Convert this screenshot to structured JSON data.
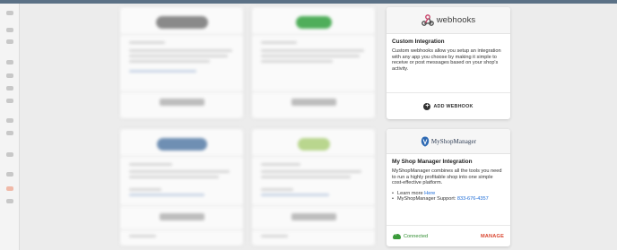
{
  "webhooks_card": {
    "logo_text": "webhooks",
    "title": "Custom Integration",
    "description": "Custom webhooks allow you setup an integration with any app you choose by making it simple to receive or post messages based on your shop's activity.",
    "button_label": "ADD WEBHOOK"
  },
  "msm_card": {
    "logo_text": "MyShopManager",
    "title": "My Shop Manager Integration",
    "description": "MyShopManager combines all the tools you need to run a highly profitable shop into one simple cost-effective platform.",
    "learn_more_prefix": "Learn more ",
    "learn_more_link": "Here",
    "support_prefix": "MyShopManager Support: ",
    "support_phone": "833-676-4357",
    "status_label": "Connected",
    "manage_label": "MANAGE"
  },
  "colors": {
    "topbar": "#5b7186",
    "connected": "#2e8b2e",
    "manage": "#d9442e",
    "link": "#1a6ad6"
  }
}
